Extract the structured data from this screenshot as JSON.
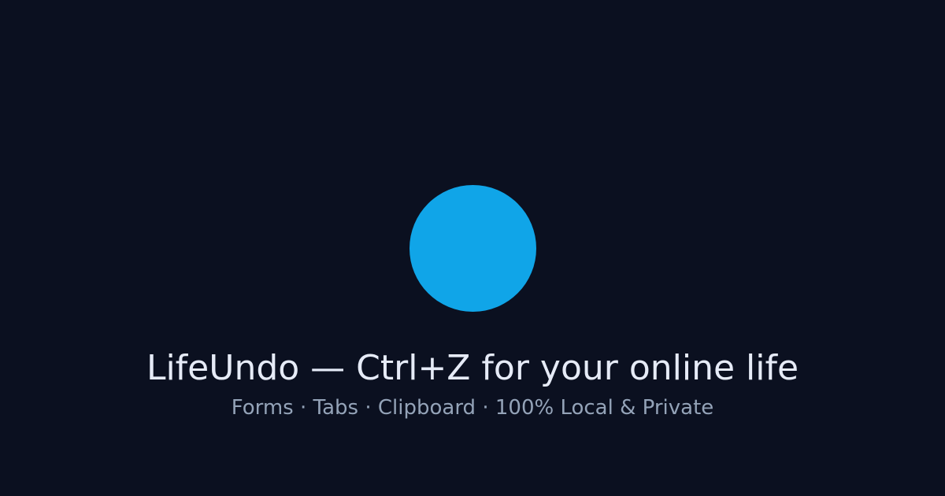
{
  "colors": {
    "background": "#0b1020",
    "logo": "#10a5e8",
    "title": "#e6ebf7",
    "subtitle": "#94a3b8"
  },
  "logo": {
    "icon": "circle-logo-icon"
  },
  "title": "LifeUndo — Ctrl+Z for your online life",
  "subtitle": "Forms · Tabs · Clipboard · 100% Local & Private"
}
